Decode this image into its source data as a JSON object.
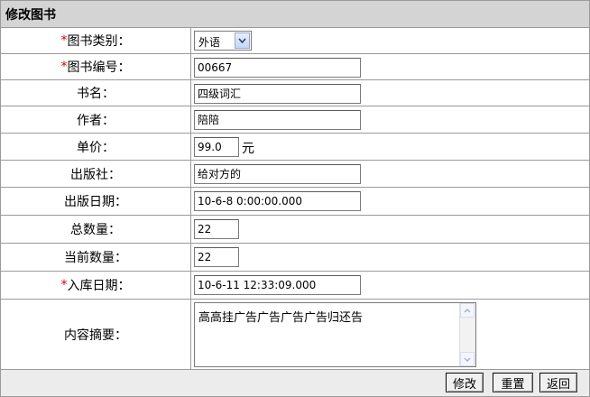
{
  "page": {
    "title": "修改图书"
  },
  "form": {
    "rows": [
      {
        "label": "图书类别：",
        "required": true,
        "type": "select",
        "value": "外语"
      },
      {
        "label": "图书编号：",
        "required": true,
        "type": "text",
        "value": "00667"
      },
      {
        "label": "书名：",
        "required": false,
        "type": "text",
        "value": "四级词汇"
      },
      {
        "label": "作者：",
        "required": false,
        "type": "text",
        "value": "陪陪"
      },
      {
        "label": "单价：",
        "required": false,
        "type": "text",
        "value": "99.0",
        "unit": "元"
      },
      {
        "label": "出版社：",
        "required": false,
        "type": "text",
        "value": "给对方的"
      },
      {
        "label": "出版日期：",
        "required": false,
        "type": "text",
        "value": "10-6-8 0:00:00.000"
      },
      {
        "label": "总数量：",
        "required": false,
        "type": "text",
        "value": "22"
      },
      {
        "label": "当前数量：",
        "required": false,
        "type": "text",
        "value": "22"
      },
      {
        "label": "入库日期：",
        "required": true,
        "type": "text",
        "value": "10-6-11 12:33:09.000"
      },
      {
        "label": "内容摘要：",
        "required": false,
        "type": "textarea",
        "value": "高高挂广告广告广告广告归还告"
      }
    ],
    "required_mark": "*"
  },
  "buttons": {
    "modify": "修改",
    "reset": "重置",
    "back": "返回"
  },
  "icons": {
    "select_arrow": "chevron-down-icon",
    "scroll_up": "arrow-up-icon",
    "scroll_down": "arrow-down-icon"
  },
  "colors": {
    "required": "#d40000",
    "header_bg": "#d4d4d4",
    "border": "#9a9a9a"
  }
}
